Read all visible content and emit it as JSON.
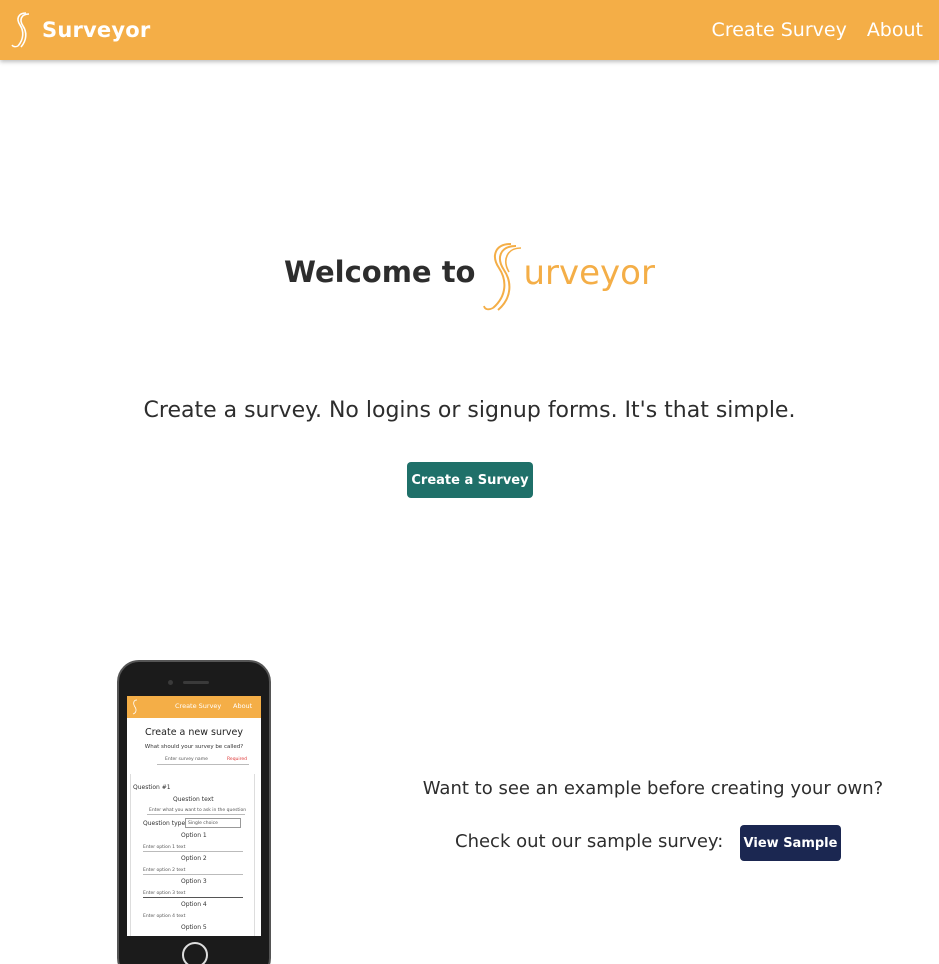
{
  "navbar": {
    "brand": "Surveyor",
    "links": [
      {
        "label": "Create Survey"
      },
      {
        "label": "About"
      }
    ],
    "color": "#f4ae47"
  },
  "hero": {
    "welcome": "Welcome to",
    "brand_suffix": "urveyor",
    "brand_color": "#f4ae47",
    "tagline": "Create a survey. No logins or signup forms. It's that simple.",
    "create_button": "Create a Survey",
    "create_button_color": "#1f7069"
  },
  "phone_mockup": {
    "nav_links": [
      "Create Survey",
      "About"
    ],
    "title": "Create a new survey",
    "subtitle": "What should your survey be called?",
    "name_placeholder": "Enter survey name",
    "required": "Required",
    "question_header": "Question #1",
    "question_text_label": "Question text",
    "question_placeholder": "Enter what you want to ask in the question",
    "question_type_label": "Question type",
    "question_type_value": "Single choice",
    "options": [
      {
        "label": "Option 1",
        "placeholder": "Enter option 1 text"
      },
      {
        "label": "Option 2",
        "placeholder": "Enter option 2 text"
      },
      {
        "label": "Option 3",
        "placeholder": "Enter option 3 text"
      },
      {
        "label": "Option 4",
        "placeholder": "Enter option 4 text"
      },
      {
        "label": "Option 5",
        "placeholder": ""
      }
    ]
  },
  "example": {
    "question": "Want to see an example before creating your own?",
    "check_text": "Check out our sample survey:",
    "sample_button": "View Sample",
    "sample_button_color": "#1b2751"
  }
}
